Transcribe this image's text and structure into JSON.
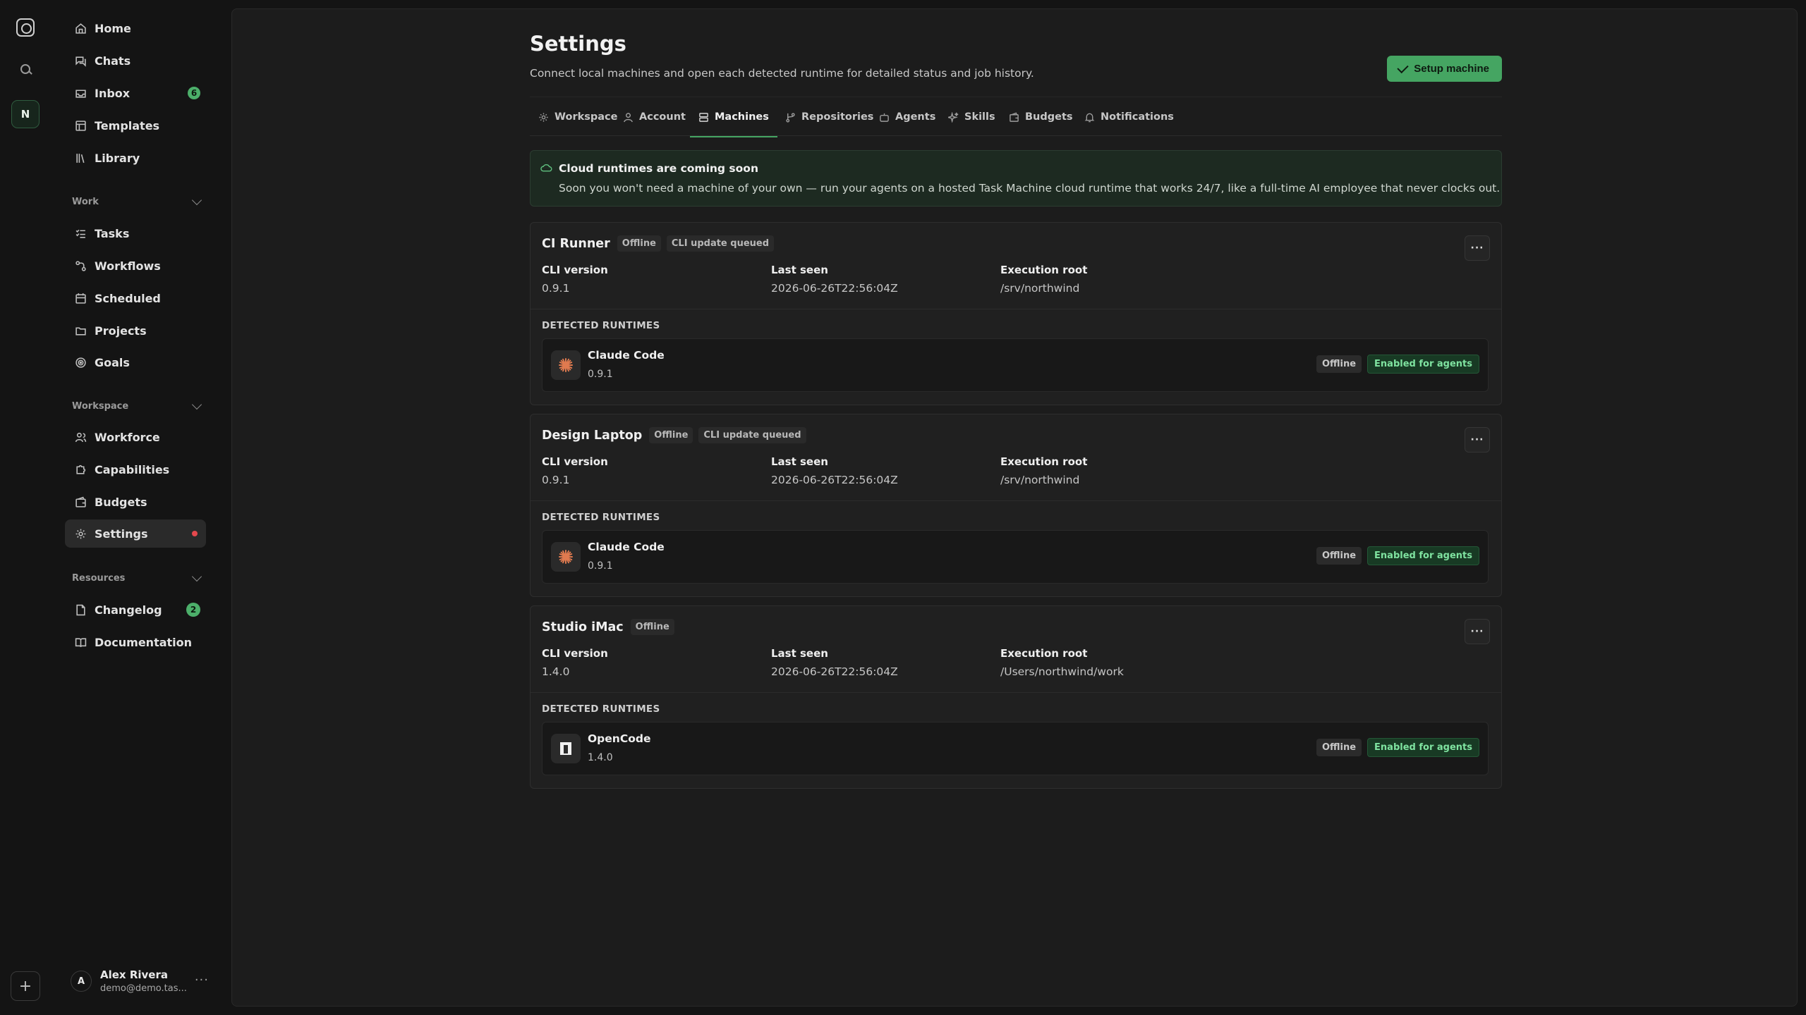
{
  "rail": {
    "workspace_initial": "N",
    "add_label": "+"
  },
  "sidebar": {
    "nav": [
      {
        "label": "Home",
        "icon": "home-icon"
      },
      {
        "label": "Chats",
        "icon": "chat-icon"
      },
      {
        "label": "Inbox",
        "icon": "inbox-icon",
        "badge": "6"
      },
      {
        "label": "Templates",
        "icon": "template-icon"
      },
      {
        "label": "Library",
        "icon": "library-icon"
      }
    ],
    "sections": [
      {
        "title": "Work",
        "items": [
          {
            "label": "Tasks",
            "icon": "tasks-icon"
          },
          {
            "label": "Workflows",
            "icon": "workflow-icon"
          },
          {
            "label": "Scheduled",
            "icon": "calendar-icon"
          },
          {
            "label": "Projects",
            "icon": "folder-icon"
          },
          {
            "label": "Goals",
            "icon": "target-icon"
          }
        ]
      },
      {
        "title": "Workspace",
        "items": [
          {
            "label": "Workforce",
            "icon": "users-icon"
          },
          {
            "label": "Capabilities",
            "icon": "puzzle-icon"
          },
          {
            "label": "Budgets",
            "icon": "wallet-icon"
          },
          {
            "label": "Settings",
            "icon": "gear-icon",
            "active": true
          }
        ]
      },
      {
        "title": "Resources",
        "items": [
          {
            "label": "Changelog",
            "icon": "file-icon",
            "badge": "2"
          },
          {
            "label": "Documentation",
            "icon": "book-icon"
          }
        ]
      }
    ],
    "user": {
      "initial": "A",
      "name": "Alex Rivera",
      "email": "demo@demo.tas..."
    }
  },
  "page": {
    "title": "Settings",
    "subtitle": "Connect local machines and open each detected runtime for detailed status and job history.",
    "setup_button": "Setup machine",
    "tabs": [
      {
        "label": "Workspace",
        "icon": "gear-icon"
      },
      {
        "label": "Account",
        "icon": "user-icon"
      },
      {
        "label": "Machines",
        "icon": "server-icon",
        "active": true
      },
      {
        "label": "Repositories",
        "icon": "git-branch-icon"
      },
      {
        "label": "Agents",
        "icon": "bot-icon"
      },
      {
        "label": "Skills",
        "icon": "sparkles-icon"
      },
      {
        "label": "Budgets",
        "icon": "wallet-icon"
      },
      {
        "label": "Notifications",
        "icon": "bell-icon"
      }
    ],
    "banner": {
      "title": "Cloud runtimes are coming soon",
      "text": "Soon you won't need a machine of your own — run your agents on a hosted Task Machine cloud runtime that works 24/7, like a full-time AI employee that never clocks out."
    },
    "labels": {
      "cli_version": "CLI version",
      "last_seen": "Last seen",
      "execution_root": "Execution root",
      "detected_runtimes": "DETECTED RUNTIMES",
      "more": "···"
    },
    "machines": [
      {
        "name": "CI Runner",
        "status": "Offline",
        "queued": "CLI update queued",
        "cli_version": "0.9.1",
        "last_seen": "2026-06-26T22:56:04Z",
        "execution_root": "/srv/northwind",
        "runtime": {
          "name": "Claude Code",
          "version": "0.9.1",
          "icon": "claude-icon",
          "status": "Offline",
          "enabled": "Enabled for agents"
        }
      },
      {
        "name": "Design Laptop",
        "status": "Offline",
        "queued": "CLI update queued",
        "cli_version": "0.9.1",
        "last_seen": "2026-06-26T22:56:04Z",
        "execution_root": "/srv/northwind",
        "runtime": {
          "name": "Claude Code",
          "version": "0.9.1",
          "icon": "claude-icon",
          "status": "Offline",
          "enabled": "Enabled for agents"
        }
      },
      {
        "name": "Studio iMac",
        "status": "Offline",
        "queued": "",
        "cli_version": "1.4.0",
        "last_seen": "2026-06-26T22:56:04Z",
        "execution_root": "/Users/northwind/work",
        "runtime": {
          "name": "OpenCode",
          "version": "1.4.0",
          "icon": "opencode-icon",
          "status": "Offline",
          "enabled": "Enabled for agents"
        }
      }
    ]
  },
  "colors": {
    "accent": "#45a562",
    "badge": "#4caf6a",
    "alert": "#e5484d",
    "enabled_text": "#7fe3a0"
  }
}
